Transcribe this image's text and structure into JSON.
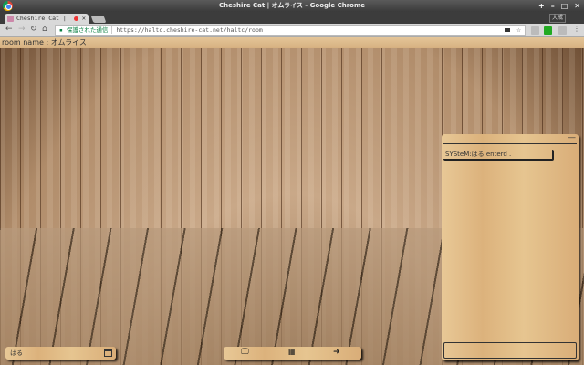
{
  "window": {
    "title": "Cheshire Cat | オムライス - Google Chrome",
    "profile": "大成"
  },
  "tab": {
    "title": "Cheshire Cat |"
  },
  "omnibox": {
    "security": "保護された通信",
    "url": "https://haltc.cheshire-cat.net/haltc/room"
  },
  "room": {
    "name_label": "room name : オムライス"
  },
  "chat": {
    "messages": [
      "SYSteM:はる enterd ."
    ],
    "input_value": ""
  },
  "user": {
    "name": "はる"
  },
  "icons": {
    "screen": "monitor-icon",
    "grid": "grid-icon",
    "exit": "sign-out-icon"
  }
}
